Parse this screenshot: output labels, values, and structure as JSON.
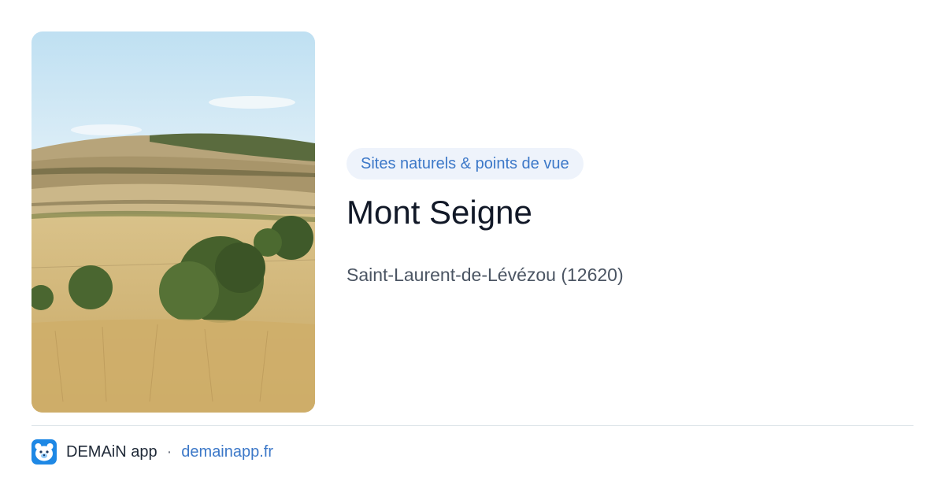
{
  "card": {
    "category": "Sites naturels & points de vue",
    "title": "Mont Seigne",
    "location": "Saint-Laurent-de-Lévézou (12620)"
  },
  "footer": {
    "app_name": "DEMAiN app",
    "separator": "·",
    "link": "demainapp.fr",
    "logo_icon": "bear-face-icon"
  },
  "colors": {
    "accent": "#3c78c8",
    "badge_bg": "#eef3fb",
    "title": "#111827",
    "muted": "#4b5563",
    "logo_bg": "#1e88e5"
  }
}
